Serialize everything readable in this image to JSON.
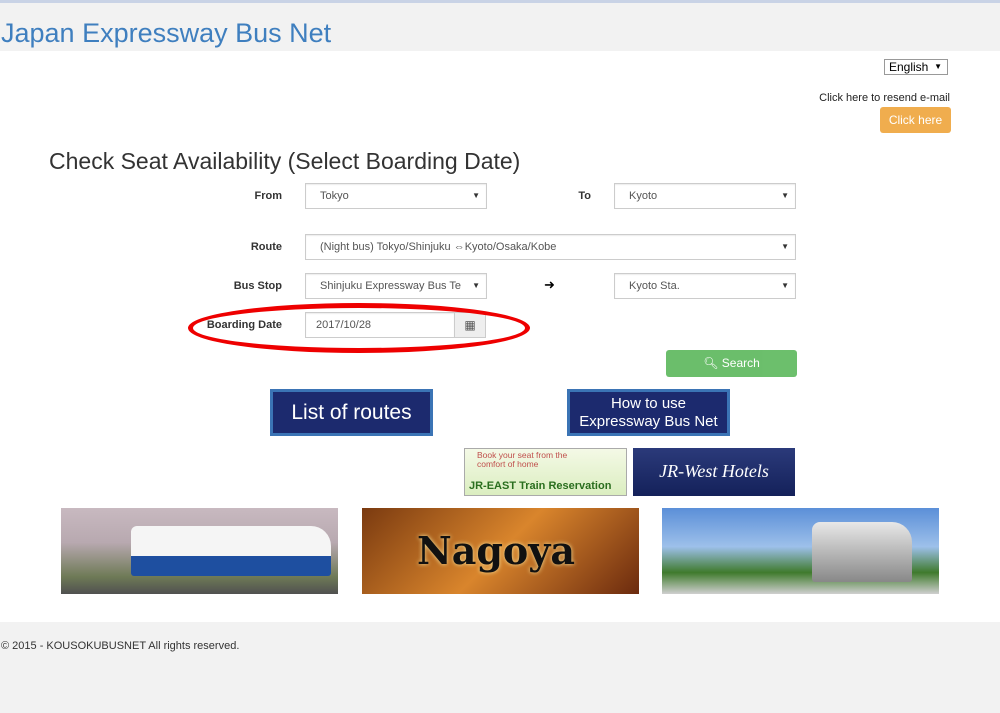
{
  "header": {
    "brand": "Japan Expressway Bus Net"
  },
  "language": {
    "selected": "English"
  },
  "resend": {
    "text": "Click here to resend e-mail",
    "button": "Click here"
  },
  "form": {
    "title": "Check Seat Availability (Select Boarding Date)",
    "from_label": "From",
    "from_value": "Tokyo",
    "to_label": "To",
    "to_value": "Kyoto",
    "route_label": "Route",
    "route_value": "(Night bus) Tokyo/Shinjuku ⇔Kyoto/Osaka/Kobe",
    "busstop_label": "Bus Stop",
    "busstop_from": "Shinjuku Expressway Bus Te",
    "busstop_to": "Kyoto Sta.",
    "arrow": "➜",
    "date_label": "Boarding Date",
    "date_value": "2017/10/28",
    "search": "Search"
  },
  "banners": {
    "routes": "List of routes",
    "howto_1": "How to use",
    "howto_2": "Expressway Bus Net",
    "jreast_top": "Book your seat from the comfort of home",
    "jreast_bottom": "JR-EAST Train Reservation",
    "jrwest": "JR-West Hotels",
    "nagoya": "Nagoya"
  },
  "footer": {
    "copyright": "© 2015 - KOUSOKUBUSNET All rights reserved."
  }
}
